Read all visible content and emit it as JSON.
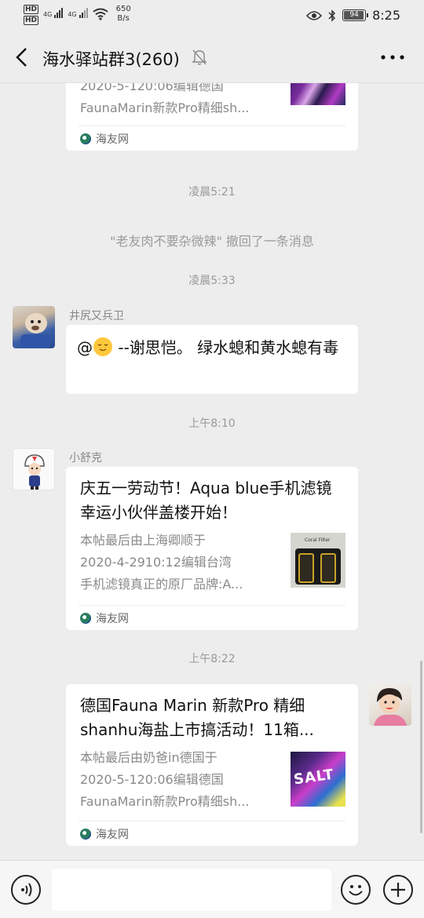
{
  "statusbar": {
    "hd1": "HD",
    "hd2": "HD",
    "net1": "4G",
    "net2": "4G",
    "speed_value": "650",
    "speed_unit": "B/s",
    "battery": "94",
    "time": "8:25"
  },
  "nav": {
    "title": "海水驿站群3(260)"
  },
  "messages": {
    "card0": {
      "desc_line2": "2020-5-120:06编辑德国",
      "desc_line3": "FaunaMarin新款Pro精细sh...",
      "source": "海友网"
    },
    "time1": "凌晨5:21",
    "recall": "\"老友肉不要杂微辣\" 撤回了一条消息",
    "time2": "凌晨5:33",
    "msg1": {
      "sender": "井尻又兵卫",
      "text_prefix": "@",
      "text_body": " --谢思恺。 绿水螅和黄水螅有毒"
    },
    "time3": "上午8:10",
    "msg2": {
      "sender": "小舒克",
      "title": "庆五一劳动节！Aqua blue手机滤镜幸运小伙伴盖楼开始！",
      "desc_line1": "本帖最后由上海卿顺于",
      "desc_line2": "2020-4-2910:12编辑台湾",
      "desc_line3": "手机滤镜真正的原厂品牌:A...",
      "thumb_label": "Coral Filter",
      "source": "海友网"
    },
    "time4": "上午8:22",
    "msg3": {
      "title": "德国Fauna Marin 新款Pro 精细shanhu海盐上市搞活动！11箱...",
      "desc_line1": "本帖最后由奶爸in德国于",
      "desc_line2": "2020-5-120:06编辑德国",
      "desc_line3": "FaunaMarin新款Pro精细sh...",
      "thumb_label": "SALT",
      "source": "海友网"
    }
  },
  "icons": {
    "back": "chevron-left-icon",
    "mute": "bell-off-icon",
    "more": "more-dots-icon",
    "voice": "voice-icon",
    "emoji": "emoji-icon",
    "plus": "plus-icon",
    "eye": "eye-icon",
    "bluetooth": "bluetooth-icon",
    "wifi": "wifi-icon"
  }
}
